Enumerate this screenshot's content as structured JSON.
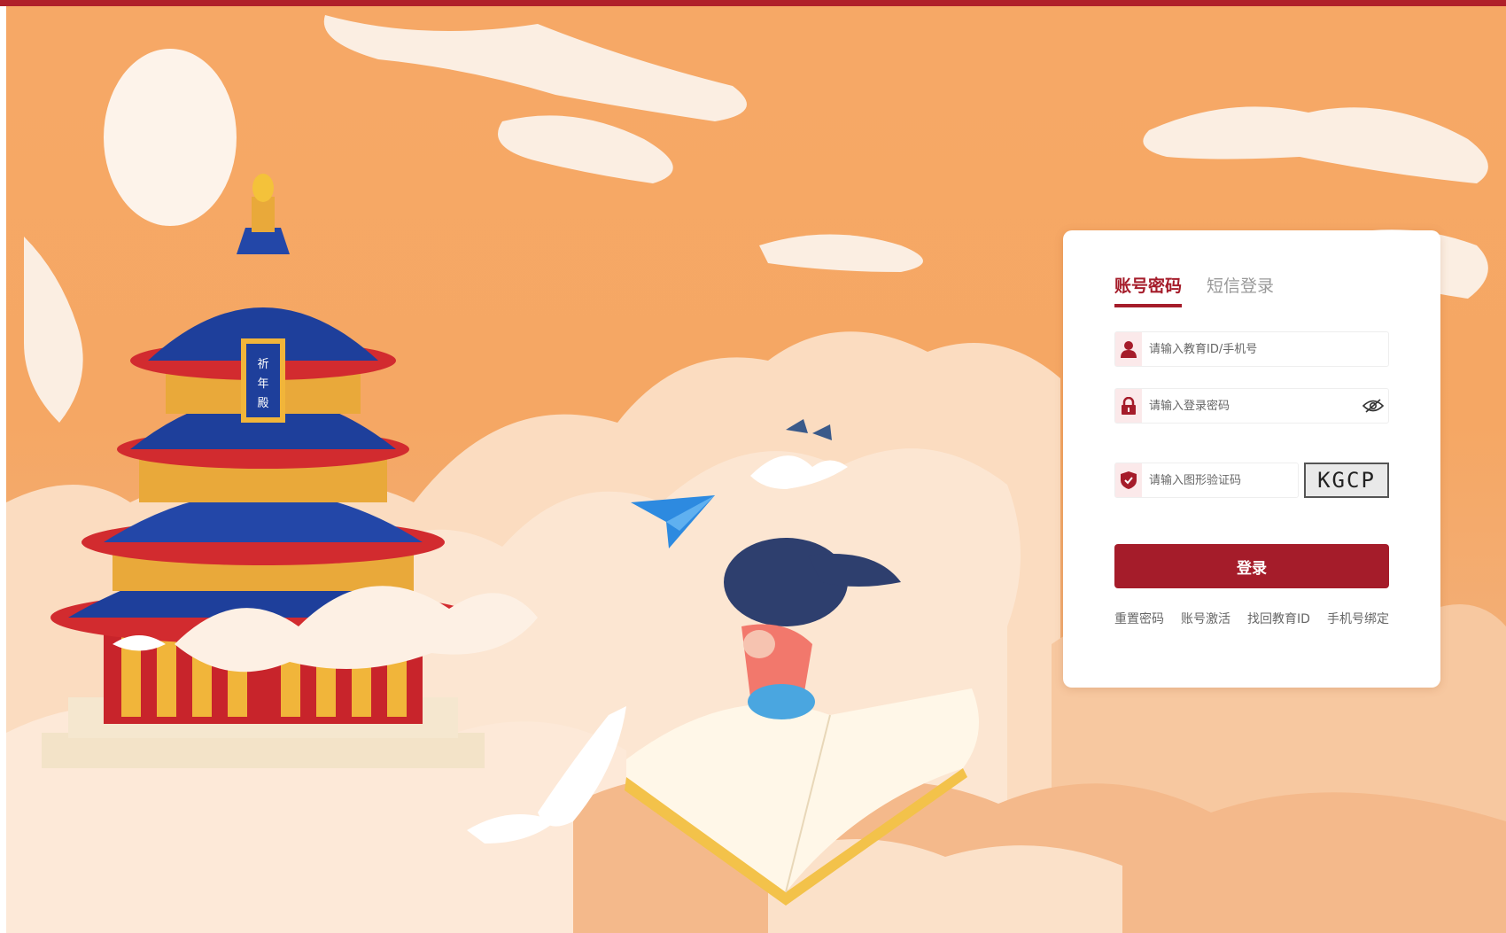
{
  "colors": {
    "brand": "#a51c2a",
    "background": "#f6a866"
  },
  "login": {
    "tabs": [
      {
        "label": "账号密码",
        "active": true
      },
      {
        "label": "短信登录",
        "active": false
      }
    ],
    "account": {
      "placeholder": "请输入教育ID/手机号",
      "icon": "user-icon"
    },
    "password": {
      "placeholder": "请输入登录密码",
      "icon": "lock-icon",
      "toggle_icon": "eye-icon"
    },
    "captcha": {
      "placeholder": "请输入图形验证码",
      "icon": "shield-check-icon",
      "image_text": "KGCP"
    },
    "submit_label": "登录",
    "links": [
      "重置密码",
      "账号激活",
      "找回教育ID",
      "手机号绑定"
    ]
  },
  "scene": {
    "temple_sign": [
      "祈",
      "年",
      "殿"
    ]
  }
}
